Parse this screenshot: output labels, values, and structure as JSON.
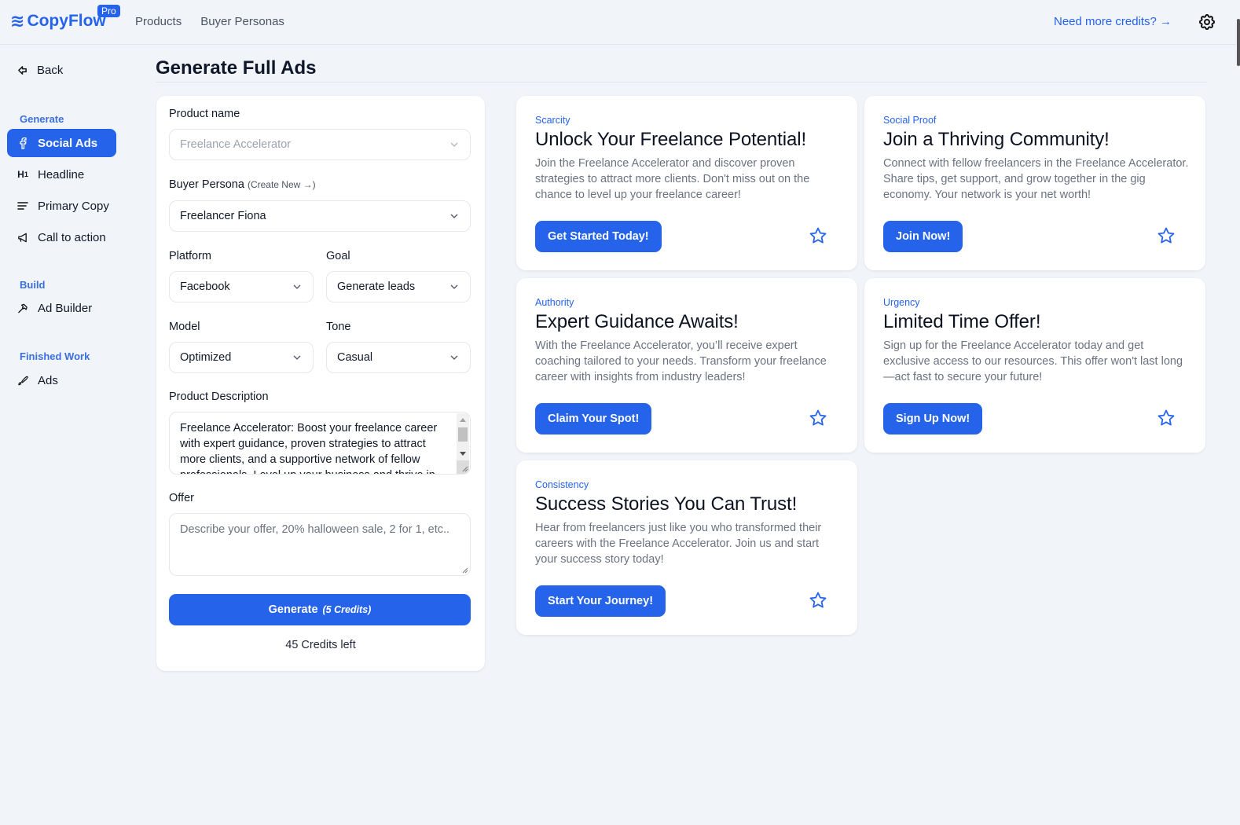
{
  "header": {
    "logo_text": "CopyFlow",
    "logo_icon": "waves-icon",
    "pro_badge": "Pro",
    "nav": [
      "Products",
      "Buyer Personas"
    ],
    "credits_link": "Need more credits? →",
    "settings_icon": "gear-icon"
  },
  "sidebar": {
    "back_label": "Back",
    "sections": [
      {
        "label": "Generate",
        "items": [
          {
            "label": "Social Ads",
            "icon": "facebook-icon",
            "active": true
          },
          {
            "label": "Headline",
            "icon": "heading-icon",
            "active": false
          },
          {
            "label": "Primary Copy",
            "icon": "text-lines-icon",
            "active": false
          },
          {
            "label": "Call to action",
            "icon": "megaphone-icon",
            "active": false
          }
        ]
      },
      {
        "label": "Build",
        "items": [
          {
            "label": "Ad Builder",
            "icon": "hammer-icon",
            "active": false
          }
        ]
      },
      {
        "label": "Finished Work",
        "items": [
          {
            "label": "Ads",
            "icon": "brush-icon",
            "active": false
          }
        ]
      }
    ]
  },
  "main": {
    "title": "Generate Full Ads",
    "form": {
      "product_name": {
        "label": "Product name",
        "value": "Freelance Accelerator"
      },
      "buyer_persona": {
        "label": "Buyer Persona",
        "create_link": "(Create New →)",
        "value": "Freelancer Fiona"
      },
      "platform": {
        "label": "Platform",
        "value": "Facebook"
      },
      "goal": {
        "label": "Goal",
        "value": "Generate leads"
      },
      "model": {
        "label": "Model",
        "value": "Optimized"
      },
      "tone": {
        "label": "Tone",
        "value": "Casual"
      },
      "product_description": {
        "label": "Product Description",
        "value": "Freelance Accelerator: Boost your freelance career with expert guidance, proven strategies to attract more clients, and a supportive network of fellow professionals. Level up your business and thrive in"
      },
      "offer": {
        "label": "Offer",
        "value": "",
        "placeholder": "Describe your offer, 20% halloween sale, 2 for 1, etc.."
      },
      "generate_button": "Generate",
      "generate_cost": "(5 Credits)",
      "credits_left": "45 Credits left"
    },
    "ads": [
      {
        "tag": "Scarcity",
        "headline": "Unlock Your Freelance Potential!",
        "body": "Join the Freelance Accelerator and discover proven strategies to attract more clients. Don't miss out on the chance to level up your freelance career!",
        "cta": "Get Started Today!"
      },
      {
        "tag": "Social Proof",
        "headline": "Join a Thriving Community!",
        "body": "Connect with fellow freelancers in the Freelance Accelerator. Share tips, get support, and grow together in the gig economy. Your network is your net worth!",
        "cta": "Join Now!"
      },
      {
        "tag": "Authority",
        "headline": "Expert Guidance Awaits!",
        "body": "With the Freelance Accelerator, you’ll receive expert coaching tailored to your needs. Transform your freelance career with insights from industry leaders!",
        "cta": "Claim Your Spot!"
      },
      {
        "tag": "Urgency",
        "headline": "Limited Time Offer!",
        "body": "Sign up for the Freelance Accelerator today and get exclusive access to our resources. This offer won't last long—act fast to secure your future!",
        "cta": "Sign Up Now!"
      },
      {
        "tag": "Consistency",
        "headline": "Success Stories You Can Trust!",
        "body": "Hear from freelancers just like you who transformed their careers with the Freelance Accelerator. Join us and start your success story today!",
        "cta": "Start Your Journey!"
      }
    ]
  },
  "colors": {
    "accent": "#2563eb",
    "background": "#f1f4f9",
    "card": "#ffffff",
    "muted_text": "#6b7280"
  }
}
